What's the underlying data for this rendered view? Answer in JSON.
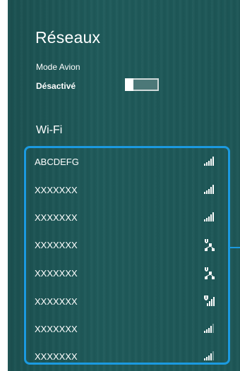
{
  "panel": {
    "title": "Réseaux",
    "airplane": {
      "label": "Mode Avion",
      "state": "Désactivé"
    },
    "wifi_heading": "Wi-Fi",
    "accent_color": "#1b9ae0",
    "background_color": "#1d5555",
    "networks": [
      {
        "name": "ABCDEFG",
        "icon": "signal-bars-icon",
        "strength": 5
      },
      {
        "name": "XXXXXXX",
        "icon": "signal-bars-icon",
        "strength": 5
      },
      {
        "name": "XXXXXXX",
        "icon": "signal-bars-icon",
        "strength": 5
      },
      {
        "name": "XXXXXXX",
        "icon": "shield-network-icon",
        "strength": null
      },
      {
        "name": "XXXXXXX",
        "icon": "shield-network-icon",
        "strength": null
      },
      {
        "name": "XXXXXXX",
        "icon": "shield-signal-icon",
        "strength": 5
      },
      {
        "name": "XXXXXXX",
        "icon": "signal-bars-icon",
        "strength": 4
      },
      {
        "name": "XXXXXXX",
        "icon": "signal-bars-icon",
        "strength": 4
      }
    ]
  }
}
